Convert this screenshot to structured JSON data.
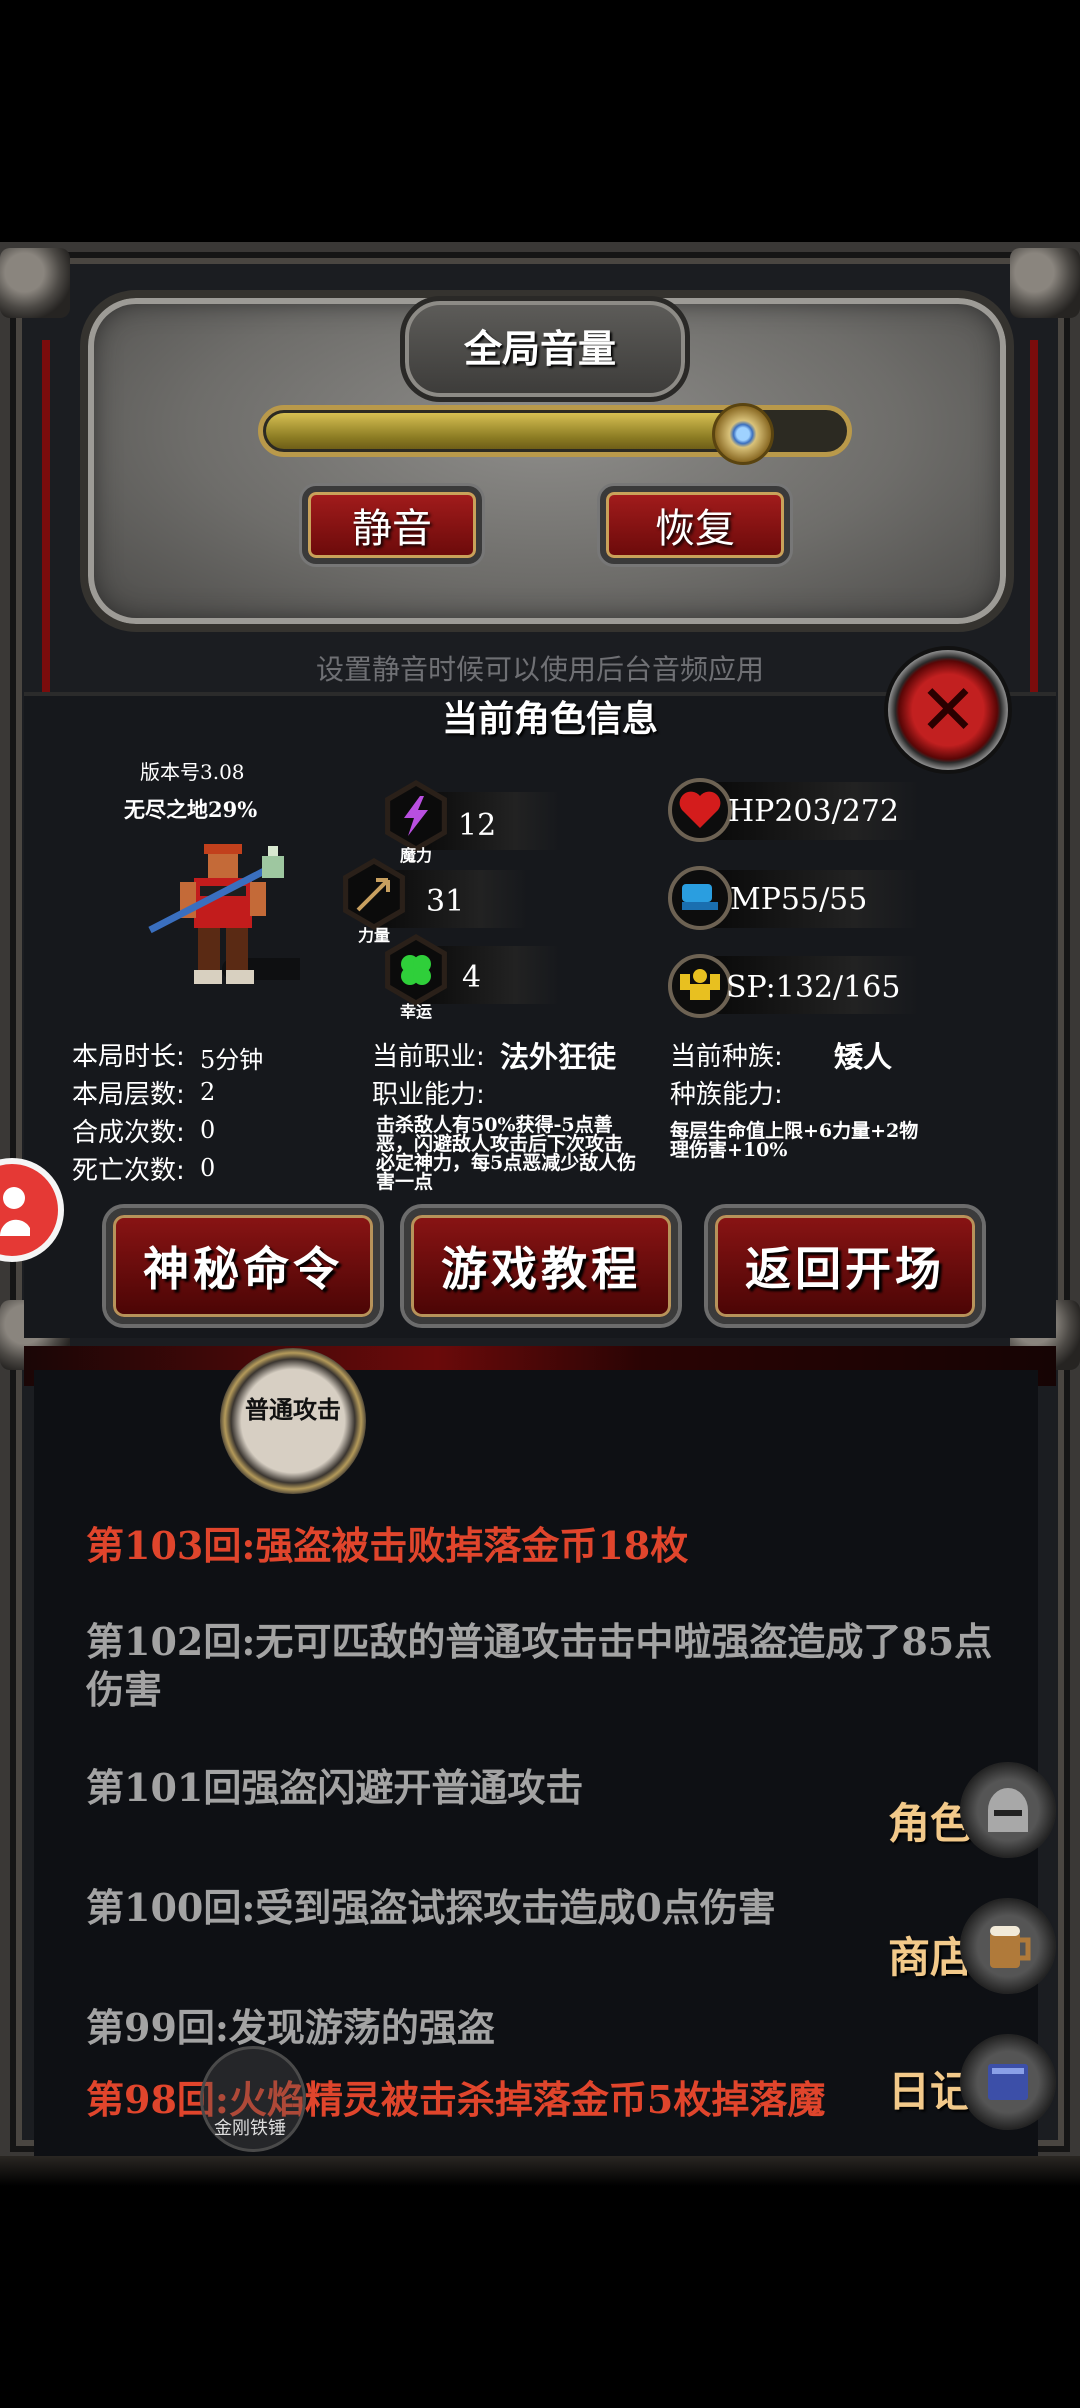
{
  "volume": {
    "title": "全局音量",
    "level_percent": 82,
    "mute_label": "静音",
    "restore_label": "恢复",
    "hint": "设置静音时候可以使用后台音频应用"
  },
  "character": {
    "title": "当前角色信息",
    "version": "版本号3.08",
    "endless": "无尽之地29%",
    "stats": {
      "magic": {
        "caption": "魔力",
        "value": "12",
        "icon": "lightning-icon"
      },
      "strength": {
        "caption": "力量",
        "value": "31",
        "icon": "trident-icon"
      },
      "luck": {
        "caption": "幸运",
        "value": "4",
        "icon": "clover-icon"
      },
      "hp": "HP203/272",
      "mp": "MP55/55",
      "sp": "SP:132/165"
    },
    "session": {
      "duration_label": "本局时长:",
      "duration_value": "5分钟",
      "floor_label": "本局层数:",
      "floor_value": "2",
      "craft_label": "合成次数:",
      "craft_value": "0",
      "death_label": "死亡次数:",
      "death_value": "0"
    },
    "class": {
      "label": "当前职业:",
      "value": "法外狂徒",
      "ability_label": "职业能力:",
      "ability_desc": "击杀敌人有50%获得-5点善恶，闪避敌人攻击后下次攻击必定神力，每5点恶减少敌人伤害一点"
    },
    "race": {
      "label": "当前种族:",
      "value": "矮人",
      "ability_label": "种族能力:",
      "ability_desc": "每层生命值上限+6力量+2物理伤害+10%"
    },
    "buttons": {
      "secret": "神秘命令",
      "tutorial": "游戏教程",
      "back": "返回开场"
    }
  },
  "skills": {
    "attack": "普通攻击",
    "hammer": "金刚铁锤"
  },
  "log": [
    {
      "text": "第103回:强盗被击败掉落金币18枚",
      "color": "red"
    },
    {
      "text": "第102回:无可匹敌的普通攻击击中啦强盗造成了85点伤害",
      "color": "grey"
    },
    {
      "text": "第101回强盗闪避开普通攻击",
      "color": "grey"
    },
    {
      "text": "第100回:受到强盗试探攻击造成0点伤害",
      "color": "grey"
    },
    {
      "text": "第99回:发现游荡的强盗",
      "color": "grey"
    },
    {
      "text": "第98回:火焰精灵被击杀掉落金币5枚掉落魔",
      "color": "red"
    }
  ],
  "side_menu": {
    "role": "角色",
    "shop": "商店",
    "diary": "日记"
  },
  "colors": {
    "log_red": "#e0452c",
    "log_grey": "#a3a3a3",
    "button_red": "#8a1414",
    "side_gold": "#f2c98a"
  }
}
